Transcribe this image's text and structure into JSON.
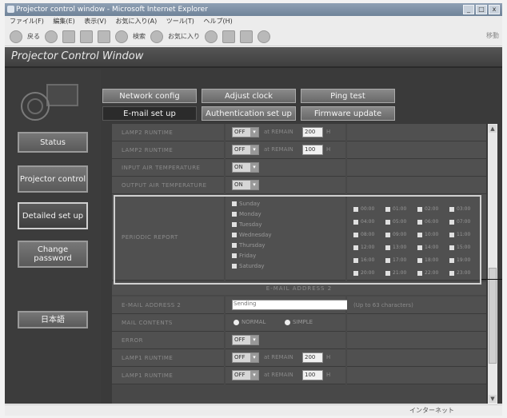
{
  "window": {
    "title": "Projector control window - Microsoft Internet Explorer",
    "buttons": [
      "_",
      "□",
      "x"
    ]
  },
  "menu": [
    "ファイル(F)",
    "編集(E)",
    "表示(V)",
    "お気に入り(A)",
    "ツール(T)",
    "ヘルプ(H)"
  ],
  "toolbar": {
    "back": "戻る",
    "search": "検索",
    "favorites": "お気に入り",
    "go": "移動"
  },
  "app": {
    "title": "Projector Control Window"
  },
  "sidebar": {
    "items": [
      {
        "label": "Status",
        "active": false
      },
      {
        "label": "Projector control",
        "active": false
      },
      {
        "label": "Detailed set up",
        "active": true
      },
      {
        "label": "Change password",
        "active": false
      },
      {
        "label": "日本語",
        "active": false
      }
    ]
  },
  "tabs": [
    {
      "label": "Network config",
      "active": false
    },
    {
      "label": "Adjust clock",
      "active": false
    },
    {
      "label": "Ping test",
      "active": false
    },
    {
      "label": "E-mail set up",
      "active": true
    },
    {
      "label": "Authentication set up",
      "active": false
    },
    {
      "label": "Firmware update",
      "active": false
    }
  ],
  "rows_top": [
    {
      "label": "LAMP2 RUNTIME",
      "select": "OFF",
      "at": "at REMAIN",
      "value": "200",
      "unit": "H"
    },
    {
      "label": "LAMP2 RUNTIME",
      "select": "OFF",
      "at": "at REMAIN",
      "value": "100",
      "unit": "H"
    },
    {
      "label": "INPUT AIR TEMPERATURE",
      "select": "ON"
    },
    {
      "label": "OUTPUT AIR TEMPERATURE",
      "select": "ON"
    }
  ],
  "period": {
    "label": "PERIODIC REPORT",
    "days": [
      "Sunday",
      "Monday",
      "Tuesday",
      "Wednesday",
      "Thursday",
      "Friday",
      "Saturday"
    ],
    "hours": [
      "00:00",
      "01:00",
      "02:00",
      "03:00",
      "04:00",
      "05:00",
      "06:00",
      "07:00",
      "08:00",
      "09:00",
      "10:00",
      "11:00",
      "12:00",
      "13:00",
      "14:00",
      "15:00",
      "16:00",
      "17:00",
      "18:00",
      "19:00",
      "20:00",
      "21:00",
      "22:00",
      "23:00"
    ]
  },
  "section_title": "E-MAIL ADDRESS 2",
  "rows_bottom": [
    {
      "label": "E-MAIL ADDRESS 2",
      "placeholder": "Sending",
      "hint": "(Up to 63 characters)"
    },
    {
      "label": "MAIL CONTENTS",
      "radio1": "NORMAL",
      "radio2": "SIMPLE"
    },
    {
      "label": "ERROR",
      "select": "OFF"
    },
    {
      "label": "LAMP1 RUNTIME",
      "select": "OFF",
      "at": "at REMAIN",
      "value": "200",
      "unit": "H"
    },
    {
      "label": "LAMP1 RUNTIME",
      "select": "OFF",
      "at": "at REMAIN",
      "value": "100",
      "unit": "H"
    }
  ],
  "status": {
    "zone": "インターネット"
  }
}
